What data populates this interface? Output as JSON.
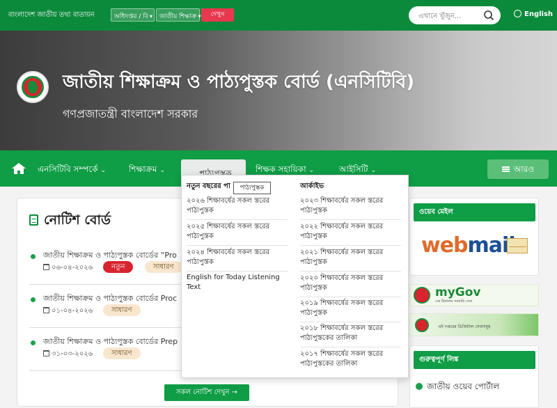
{
  "topbar": {
    "portal_name": "বাংলাদেশ জাতীয় তথ্য বাতায়ন",
    "select_office_type": "অধিদপ্তর / বি",
    "select_office": "জাতীয় শিক্ষাক্র",
    "go_label": "দেখুন",
    "search_placeholder": "এখানে খুঁজুন...",
    "language_label": "English"
  },
  "banner": {
    "title": "জাতীয় শিক্ষাক্রম ও পাঠ্যপুস্তক বোর্ড (এনসিটিবি)",
    "subtitle": "গণপ্রজাতন্ত্রী বাংলাদেশ সরকার"
  },
  "nav": {
    "items": [
      "এনসিটিবি সম্পর্কে",
      "শিক্ষাক্রম",
      "পাঠ্যপুস্তক",
      "শিক্ষক সহায়িকা",
      "আইসিটি"
    ],
    "more_label": "আরও"
  },
  "dropdown": {
    "tooltip": "পাঠ্যপুস্তক",
    "col1_head": "নতুন বছরের পা",
    "col1_items": [
      "২০২৬ শিক্ষাবর্ষের সকল স্তরের পাঠ্যপুস্তক",
      "২০২৫ শিক্ষাবর্ষের সকল স্তরের পাঠ্যপুস্তক",
      "২০২৪ শিক্ষাবর্ষের সকল স্তরের পাঠ্যপুস্তক",
      "English for Today Listening Text"
    ],
    "col2_head": "আর্কাইভ",
    "col2_items": [
      "২০২৩ শিক্ষাবর্ষের সকল স্তরের পাঠ্যপুস্তক",
      "২০২২ শিক্ষাবর্ষের সকল স্তরের পাঠ্যপুস্তক",
      "২০২১ শিক্ষাবর্ষের সকল স্তরের পাঠ্যপুস্তক",
      "২০২০ শিক্ষাবর্ষের সকল স্তরের পাঠ্যপুস্তক",
      "২০১৯ শিক্ষাবর্ষের সকল স্তরের পাঠ্যপুস্তক",
      "২০১৮ শিক্ষাবর্ষের সকল স্তরের পাঠ্যপুস্তকের তালিকা",
      "২০১৭ শিক্ষাবর্ষের সকল স্তরের পাঠ্যপুস্তকের তালিকা"
    ]
  },
  "notice_board": {
    "title": "নোটিশ বোর্ড",
    "notices": [
      {
        "text": "জাতীয় শিক্ষাক্রম ও পাঠ্যপুস্তক বোর্ডের “Pro",
        "date": "০৬-০৪-২০২৬",
        "badges": [
          "নতুন",
          "সাধারণ"
        ]
      },
      {
        "text": "জাতীয় শিক্ষাক্রম ও পাঠ্যপুস্তক বোর্ডের Proc",
        "date": "০১-০৪-২০২৬",
        "badges": [
          "সাধারণ"
        ]
      },
      {
        "text": "জাতীয় শিক্ষাক্রম ও পাঠ্যপুস্তক বোর্ডের Prep",
        "date": "৩১-০৩-২০২৬",
        "badges": [
          "সাধারণ"
        ]
      }
    ],
    "all_button": "সকল নোটিশ দেখুন →"
  },
  "sidebar": {
    "webmail_head": "ওয়েব মেইল",
    "webmail_logo_a": "web",
    "webmail_logo_b": "mail",
    "mygov_name": "myGov",
    "mygov_tagline": "এক ঠিকানায় সরকারি সেবা",
    "digital_text": "এই দপ্তরের ডিজিটাল সেবাসমূহ",
    "important_head": "গুরুত্বপূর্ণ লিঙ্ক",
    "important_links": [
      "জাতীয় ওয়েব পোর্টাল"
    ]
  },
  "colors": {
    "primary_green": "#0f9d46",
    "dark_green": "#0c8a3c",
    "accent_red": "#e8384f"
  }
}
